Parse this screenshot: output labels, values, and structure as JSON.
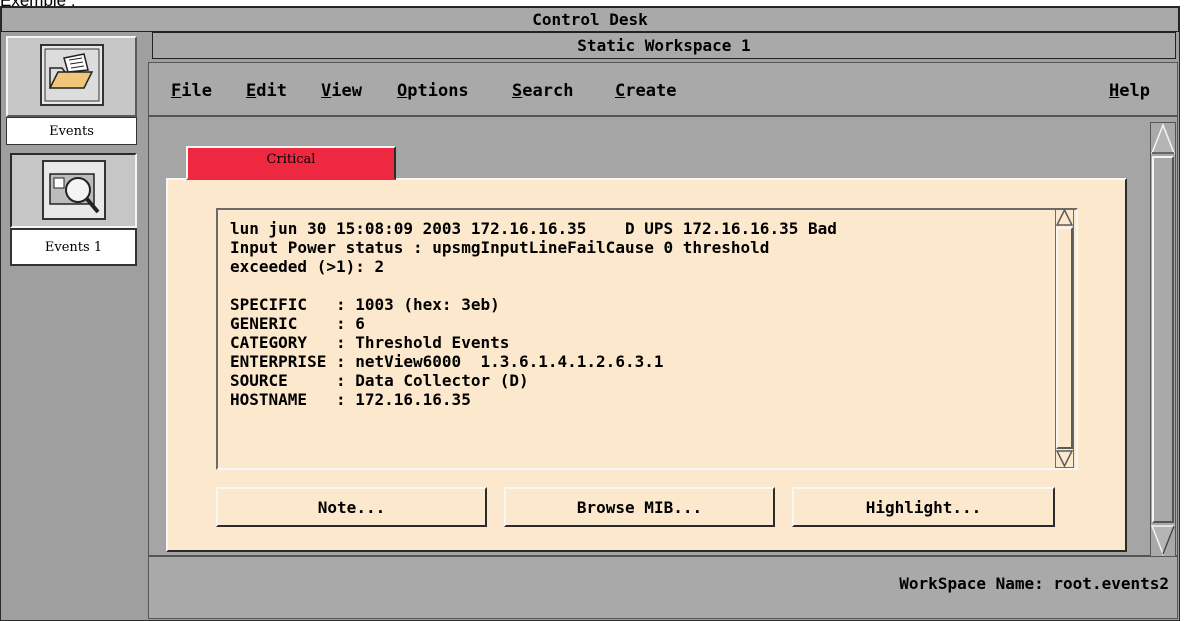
{
  "caption": "Exemple :",
  "window": {
    "title": "Control Desk"
  },
  "icon_bar": [
    {
      "label": "Events",
      "icon": "events-folder-icon"
    },
    {
      "label": "Events 1",
      "icon": "events-magnifier-icon"
    }
  ],
  "workspace": {
    "title": "Static Workspace 1",
    "menus": [
      {
        "u": "F",
        "rest": "ile"
      },
      {
        "u": "E",
        "rest": "dit"
      },
      {
        "u": "V",
        "rest": "iew"
      },
      {
        "u": "O",
        "rest": "ptions"
      },
      {
        "u": "S",
        "rest": "earch"
      },
      {
        "u": "C",
        "rest": "reate"
      }
    ],
    "help": {
      "u": "H",
      "rest": "elp"
    }
  },
  "tab": {
    "label": "Critical",
    "color": "#ee2840"
  },
  "event_text": "lun jun 30 15:08:09 2003 172.16.16.35    D UPS 172.16.16.35 Bad\nInput Power status : upsmgInputLineFailCause 0 threshold\nexceeded (>1): 2\n\nSPECIFIC   : 1003 (hex: 3eb)\nGENERIC    : 6\nCATEGORY   : Threshold Events\nENTERPRISE : netView6000  1.3.6.1.4.1.2.6.3.1\nSOURCE     : Data Collector (D)\nHOSTNAME   : 172.16.16.35",
  "buttons": {
    "note": "Note...",
    "browse": "Browse MIB...",
    "highlight": "Highlight..."
  },
  "status": {
    "workspace_name": "WorkSpace Name: root.events2"
  }
}
